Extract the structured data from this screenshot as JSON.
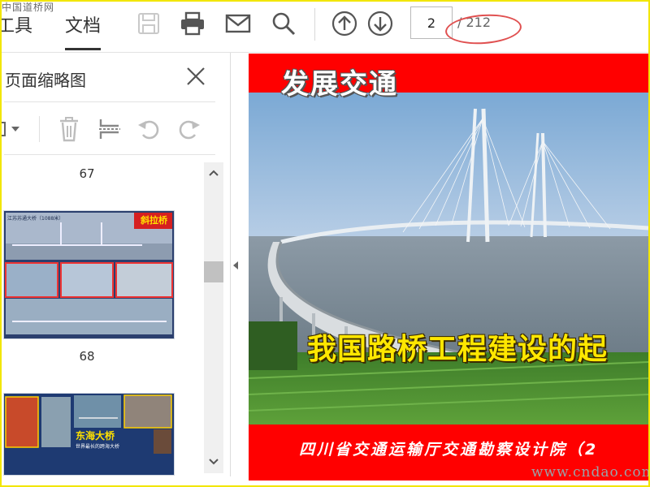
{
  "watermark_top": "中国道桥网",
  "watermark_bottom": "www.cndao.com",
  "toolbar": {
    "tab_tools": "工具",
    "tab_documents": "文档",
    "save_icon": "save-icon",
    "print_icon": "print-icon",
    "email_icon": "email-icon",
    "search_icon": "search-icon",
    "prev_page_icon": "arrow-up-circle-icon",
    "next_page_icon": "arrow-down-circle-icon",
    "page_current": "2",
    "page_total": "/ 212"
  },
  "panel": {
    "title": "页面缩略图",
    "thumbnails": [
      {
        "page": "67",
        "banner": "斜拉桥",
        "caption_top": "江苏苏通大桥（1088米）"
      },
      {
        "page": "68",
        "banner": "东海大桥",
        "caption": "世界最长的跨海大桥"
      }
    ]
  },
  "document": {
    "title": "发展交通",
    "headline": "我国路桥工程建设的起",
    "footer": "四川省交通运输厅交通勘察设计院（2"
  },
  "colors": {
    "accent_red": "#ff0000",
    "headline_yellow": "#ffe700",
    "annotation_red": "#e05050",
    "frame_yellow": "#f2e600"
  }
}
